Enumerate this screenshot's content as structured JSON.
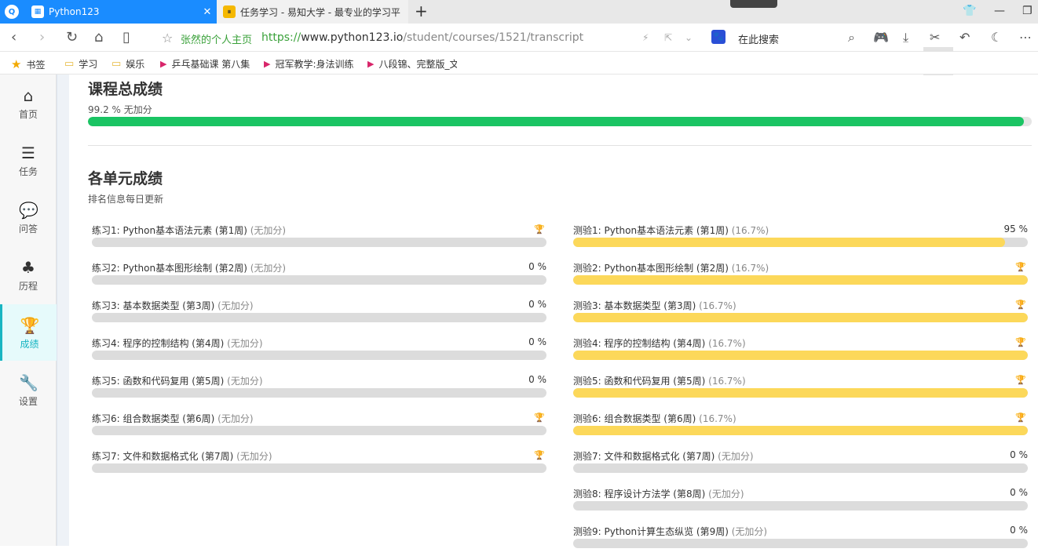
{
  "browser": {
    "tabs": [
      {
        "title": "Python123",
        "active": true
      },
      {
        "title": "任务学习 - 易知大学 - 最专业的学习平",
        "active": false
      }
    ],
    "newtab": "+",
    "bookmark_name": "张然的个人主页",
    "url_scheme": "https://",
    "url_host": "www.python123.io",
    "url_path": "/student/courses/1521/transcript",
    "search_engine_icon": "🐾",
    "search_placeholder": "在此搜索",
    "bookmarks": [
      {
        "label": "书签",
        "icon": "star-icon"
      },
      {
        "label": "学习",
        "icon": "folder-icon"
      },
      {
        "label": "娱乐",
        "icon": "folder-icon"
      },
      {
        "label": "乒乓基础课 第八集",
        "icon": "video-icon"
      },
      {
        "label": "冠军教学:身法训练",
        "icon": "video-icon"
      },
      {
        "label": "八段锦、完整版_文",
        "icon": "video-icon"
      }
    ]
  },
  "sidebar": {
    "items": [
      {
        "label": "首页",
        "icon": "home-icon",
        "glyph": "⌂"
      },
      {
        "label": "任务",
        "icon": "tasks-icon",
        "glyph": "☰"
      },
      {
        "label": "问答",
        "icon": "chat-icon",
        "glyph": "💬"
      },
      {
        "label": "历程",
        "icon": "tree-icon",
        "glyph": "♣"
      },
      {
        "label": "成绩",
        "icon": "trophy-icon",
        "glyph": "🏆"
      },
      {
        "label": "设置",
        "icon": "wrench-icon",
        "glyph": "🔧"
      }
    ]
  },
  "total": {
    "title": "课程总成绩",
    "score_text": "99.2 % 无加分",
    "score": 99.2
  },
  "units": {
    "title": "各单元成绩",
    "subtitle": "排名信息每日更新",
    "exercises": [
      {
        "name": "练习1: Python基本语法元素 (第1周)",
        "weight": "(无加分)",
        "pct_text": "",
        "trophy": true,
        "progress": 0
      },
      {
        "name": "练习2: Python基本图形绘制 (第2周)",
        "weight": "(无加分)",
        "pct_text": "0 %",
        "trophy": false,
        "progress": 0
      },
      {
        "name": "练习3: 基本数据类型 (第3周)",
        "weight": "(无加分)",
        "pct_text": "0 %",
        "trophy": false,
        "progress": 0
      },
      {
        "name": "练习4: 程序的控制结构 (第4周)",
        "weight": "(无加分)",
        "pct_text": "0 %",
        "trophy": false,
        "progress": 0
      },
      {
        "name": "练习5: 函数和代码复用 (第5周)",
        "weight": "(无加分)",
        "pct_text": "0 %",
        "trophy": false,
        "progress": 0
      },
      {
        "name": "练习6: 组合数据类型 (第6周)",
        "weight": "(无加分)",
        "pct_text": "",
        "trophy": true,
        "progress": 0
      },
      {
        "name": "练习7: 文件和数据格式化 (第7周)",
        "weight": "(无加分)",
        "pct_text": "",
        "trophy": true,
        "progress": 0
      }
    ],
    "quizzes": [
      {
        "name": "测验1: Python基本语法元素 (第1周)",
        "weight": "(16.7%)",
        "pct_text": "95 %",
        "trophy": false,
        "progress": 95
      },
      {
        "name": "测验2: Python基本图形绘制 (第2周)",
        "weight": "(16.7%)",
        "pct_text": "",
        "trophy": true,
        "progress": 100
      },
      {
        "name": "测验3: 基本数据类型 (第3周)",
        "weight": "(16.7%)",
        "pct_text": "",
        "trophy": true,
        "progress": 100
      },
      {
        "name": "测验4: 程序的控制结构 (第4周)",
        "weight": "(16.7%)",
        "pct_text": "",
        "trophy": true,
        "progress": 100
      },
      {
        "name": "测验5: 函数和代码复用 (第5周)",
        "weight": "(16.7%)",
        "pct_text": "",
        "trophy": true,
        "progress": 100
      },
      {
        "name": "测验6: 组合数据类型 (第6周)",
        "weight": "(16.7%)",
        "pct_text": "",
        "trophy": true,
        "progress": 100
      },
      {
        "name": "测验7: 文件和数据格式化 (第7周)",
        "weight": "(无加分)",
        "pct_text": "0 %",
        "trophy": false,
        "progress": 0
      },
      {
        "name": "测验8: 程序设计方法学 (第8周)",
        "weight": "(无加分)",
        "pct_text": "0 %",
        "trophy": false,
        "progress": 0
      },
      {
        "name": "测验9: Python计算生态纵览 (第9周)",
        "weight": "(无加分)",
        "pct_text": "0 %",
        "trophy": false,
        "progress": 0
      }
    ]
  },
  "colors": {
    "accent": "#18b5c2",
    "total_fill": "#1ac463",
    "unit_fill": "#fcd85a",
    "trophy": "#f0b400"
  }
}
